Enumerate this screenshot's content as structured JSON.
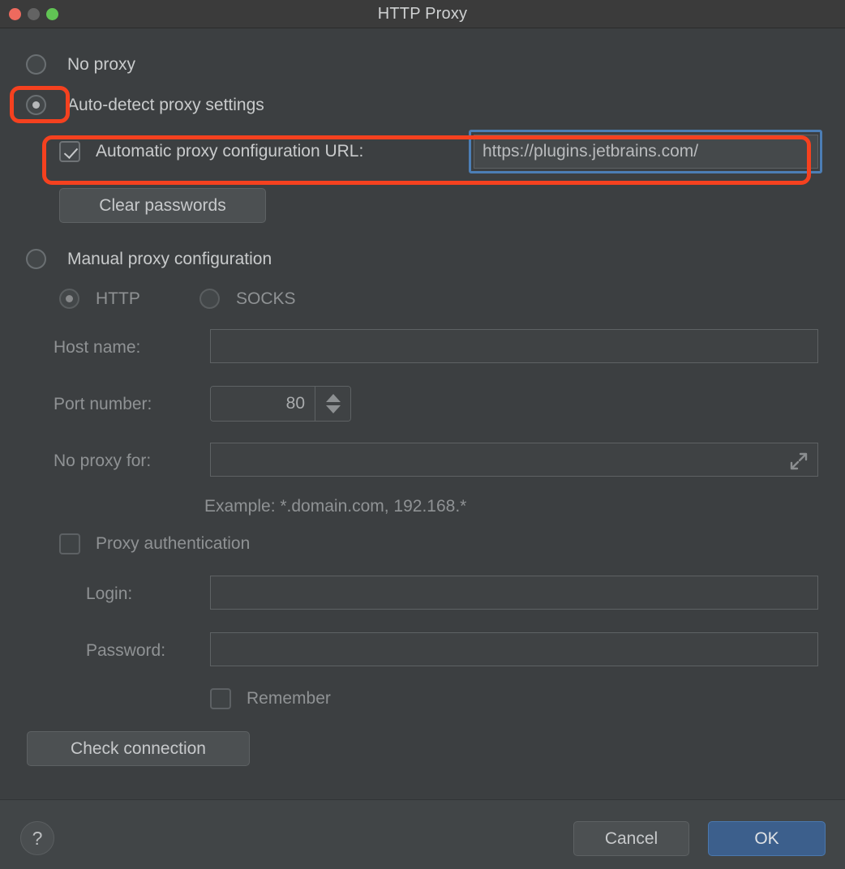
{
  "window": {
    "title": "HTTP Proxy",
    "traffic_lights": [
      "close-button",
      "minimize-button",
      "maximize-button"
    ]
  },
  "proxy_mode": {
    "no_proxy": {
      "label": "No proxy",
      "selected": false
    },
    "auto_detect": {
      "label": "Auto-detect proxy settings",
      "selected": true
    },
    "manual": {
      "label": "Manual proxy configuration",
      "selected": false
    }
  },
  "auto_section": {
    "pac_checkbox_label": "Automatic proxy configuration URL:",
    "pac_checked": true,
    "pac_url_value": "https://plugins.jetbrains.com/",
    "clear_passwords_label": "Clear passwords"
  },
  "manual_section": {
    "protocol": {
      "http_label": "HTTP",
      "http_selected": true,
      "socks_label": "SOCKS",
      "socks_selected": false
    },
    "host_name_label": "Host name:",
    "host_name_value": "",
    "port_number_label": "Port number:",
    "port_number_value": "80",
    "no_proxy_for_label": "No proxy for:",
    "no_proxy_for_value": "",
    "example_hint": "Example: *.domain.com, 192.168.*",
    "proxy_auth_label": "Proxy authentication",
    "proxy_auth_checked": false,
    "login_label": "Login:",
    "login_value": "",
    "password_label": "Password:",
    "password_value": "",
    "remember_label": "Remember",
    "remember_checked": false
  },
  "actions": {
    "check_connection_label": "Check connection",
    "help_label": "?",
    "cancel_label": "Cancel",
    "ok_label": "OK"
  },
  "annotations": {
    "highlight_color": "#f5411f",
    "focus_color": "#4c7eb5",
    "highlights": [
      {
        "name": "auto-detect-radio-highlight"
      },
      {
        "name": "pac-url-row-highlight"
      }
    ]
  }
}
